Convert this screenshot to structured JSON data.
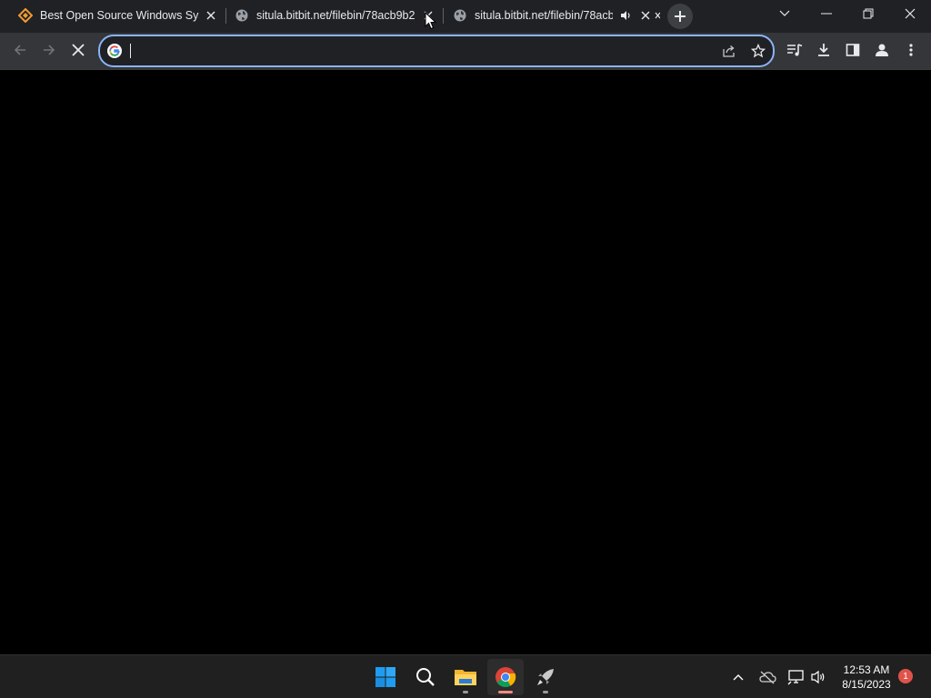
{
  "browser": {
    "tabs": [
      {
        "title": "Best Open Source Windows Syste",
        "favicon": "brand-diamond-icon",
        "active": false
      },
      {
        "title": "situla.bitbit.net/filebin/78acb9b2",
        "favicon": "globe-icon",
        "active": false
      },
      {
        "title": "situla.bitbit.net/filebin/78acb",
        "favicon": "globe-icon",
        "active": false,
        "audio": true
      }
    ],
    "omnibox": {
      "value": "",
      "placeholder": ""
    },
    "colors": {
      "accent": "#8ab4f8",
      "tabstrip": "#202124",
      "toolbar": "#35363a",
      "favicon_orange": "#f29b34"
    }
  },
  "taskbar": {
    "apps": [
      {
        "name": "start",
        "icon": "windows-logo-icon"
      },
      {
        "name": "search",
        "icon": "search-icon"
      },
      {
        "name": "file-explorer",
        "icon": "folder-icon"
      },
      {
        "name": "chrome",
        "icon": "chrome-icon",
        "active": true
      },
      {
        "name": "rocket-app",
        "icon": "rocket-icon"
      }
    ],
    "clock": {
      "time": "12:53 AM",
      "date": "8/15/2023"
    },
    "notification_count": "1"
  }
}
